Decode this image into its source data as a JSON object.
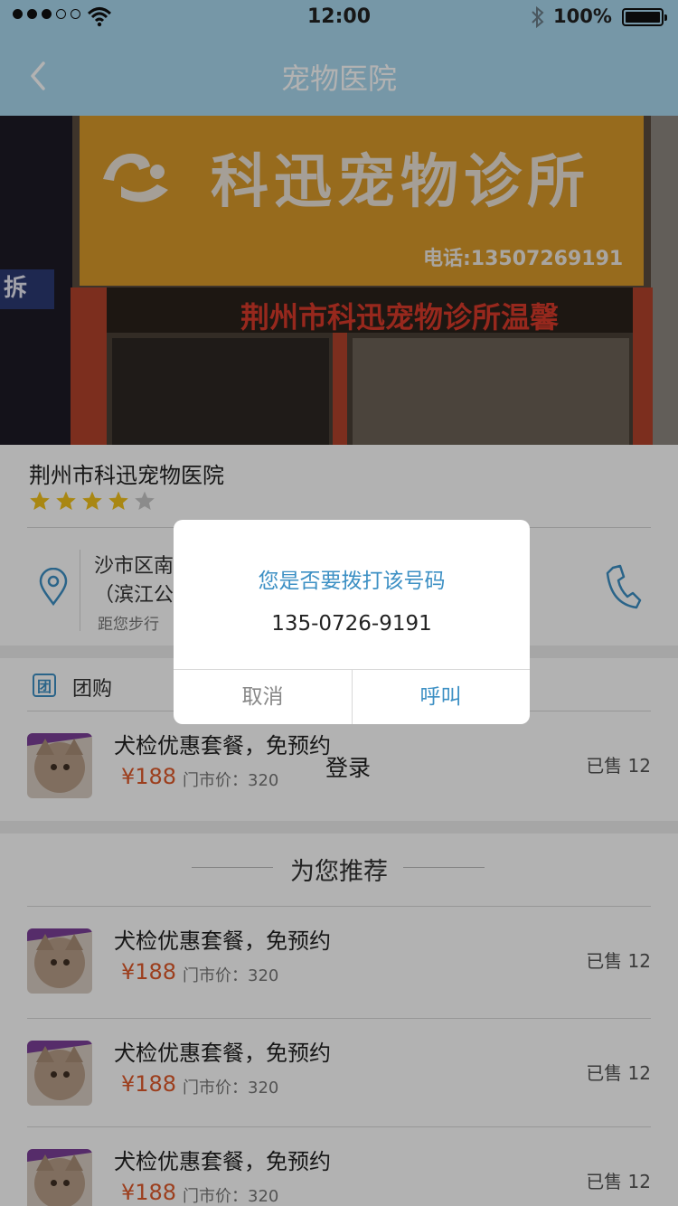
{
  "status_bar": {
    "time": "12:00",
    "battery": "100%",
    "icons": [
      "signal-dots-icon",
      "wifi-icon",
      "bluetooth-icon",
      "battery-icon"
    ]
  },
  "nav": {
    "title": "宠物医院",
    "back_icon": "chevron-left-icon"
  },
  "banner": {
    "sign_text": "科迅宠物诊所",
    "sign_phone": "电话:13507269191",
    "led_text": "荆州市科迅宠物诊所温馨",
    "left_sign_text": "拆"
  },
  "hospital": {
    "name": "荆州市科迅宠物医院",
    "rating": 4,
    "rating_max": 5,
    "address_line1": "沙市区南",
    "address_line2": "（滨江公",
    "distance": "距您步行",
    "icons": [
      "location-pin-icon",
      "phone-icon"
    ]
  },
  "group_section": {
    "icon_glyph": "团",
    "label": "团购"
  },
  "deal": {
    "title": "犬检优惠套餐，免预约",
    "price": "¥188",
    "original_price": "门市价：320",
    "sold": "已售 12"
  },
  "recommend": {
    "title": "为您推荐",
    "items": [
      {
        "title": "犬检优惠套餐，免预约",
        "price": "¥188",
        "original_price": "门市价：320",
        "sold": "已售 12"
      },
      {
        "title": "犬检优惠套餐，免预约",
        "price": "¥188",
        "original_price": "门市价：320",
        "sold": "已售 12"
      },
      {
        "title": "犬检优惠套餐，免预约",
        "price": "¥188",
        "original_price": "门市价：320",
        "sold": "已售 12"
      }
    ]
  },
  "login_text": "登录",
  "dialog": {
    "title": "您是否要拨打该号码",
    "number": "135-0726-9191",
    "cancel": "取消",
    "call": "呼叫"
  },
  "colors": {
    "nav_bg": "#a9d8ef",
    "accent": "#3d90c4",
    "price": "#e05a2a",
    "star_on": "#f2c21b",
    "star_off": "#c8c8c8",
    "overlay": "rgba(0,0,0,0.3)"
  }
}
